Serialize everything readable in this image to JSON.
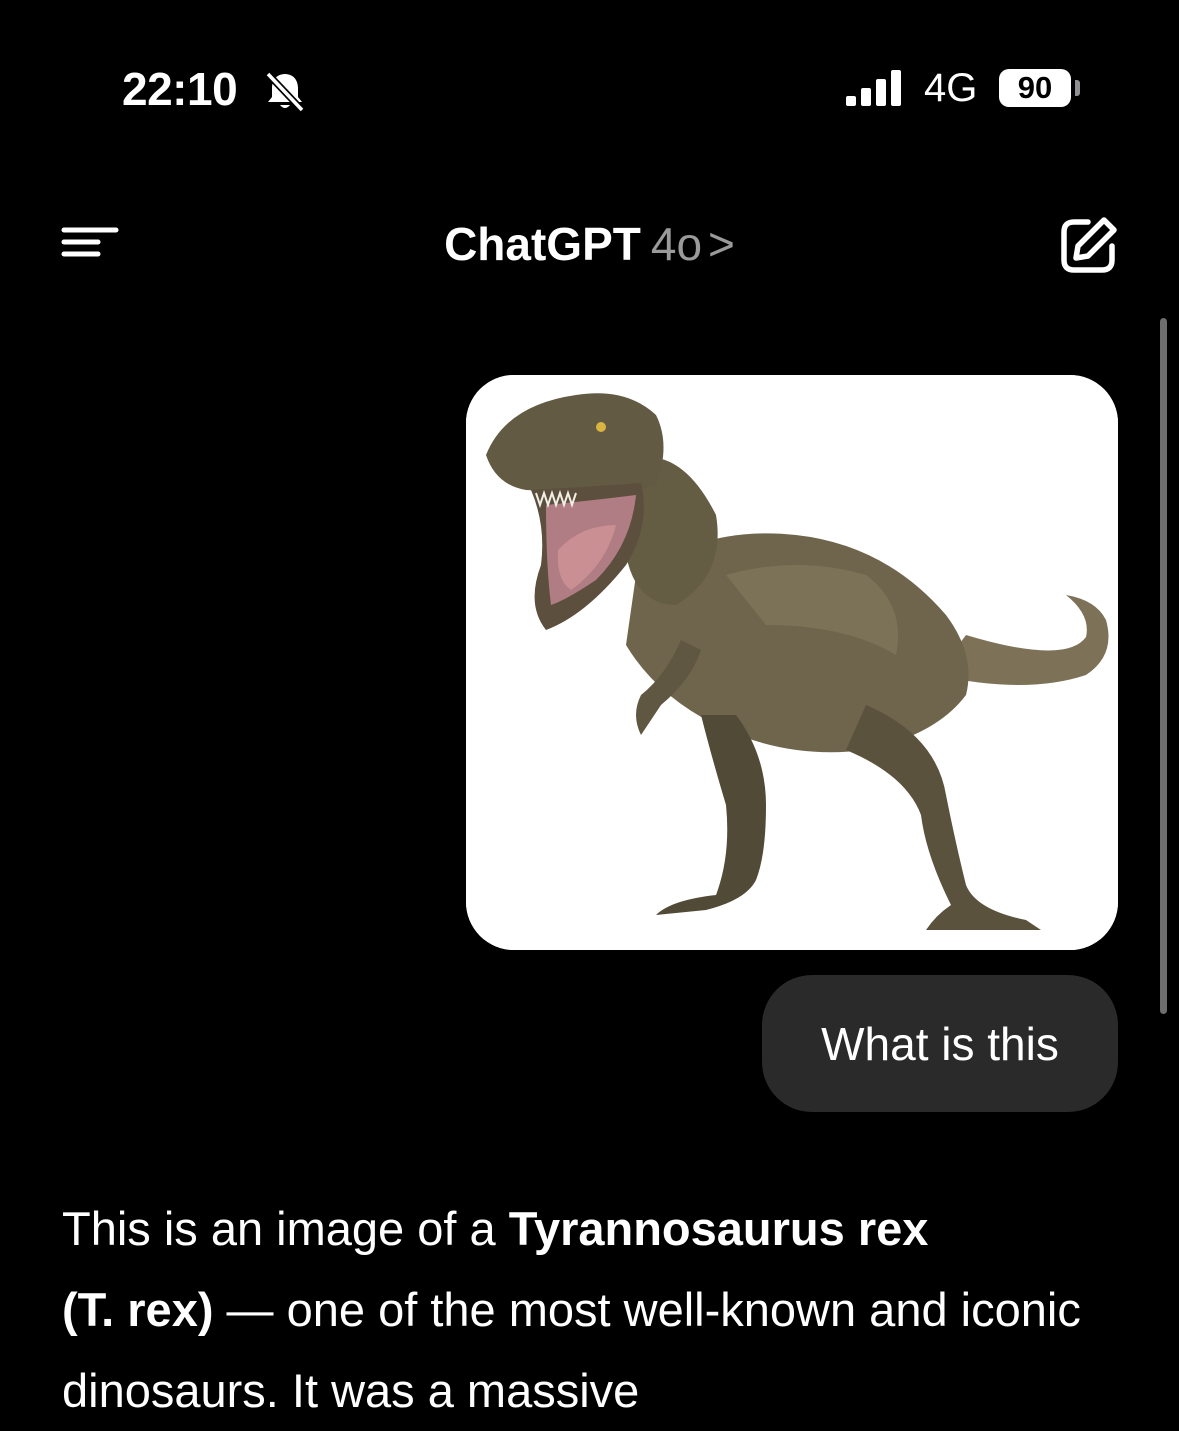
{
  "status_bar": {
    "time": "22:10",
    "network": "4G",
    "battery": "90",
    "icons": [
      "bell-slash-icon",
      "signal-icon",
      "battery-icon"
    ]
  },
  "header": {
    "title": "ChatGPT",
    "model": "4o",
    "chevron": ">",
    "icons": [
      "menu-icon",
      "new-chat-edit-icon"
    ]
  },
  "conversation": {
    "user_image": {
      "icon": "t-rex-photo",
      "background": "#ffffff"
    },
    "user_message": "What is this",
    "assistant_message": {
      "part1": "This is an image of a ",
      "bold1": "Tyrannosaurus rex",
      "bold2": "(T. rex)",
      "part2": " — one of the most well-known and iconic dinosaurs. It was a massive"
    }
  },
  "colors": {
    "background": "#000000",
    "bubble": "#2a2a2a",
    "muted_text": "#9a9a9a"
  }
}
